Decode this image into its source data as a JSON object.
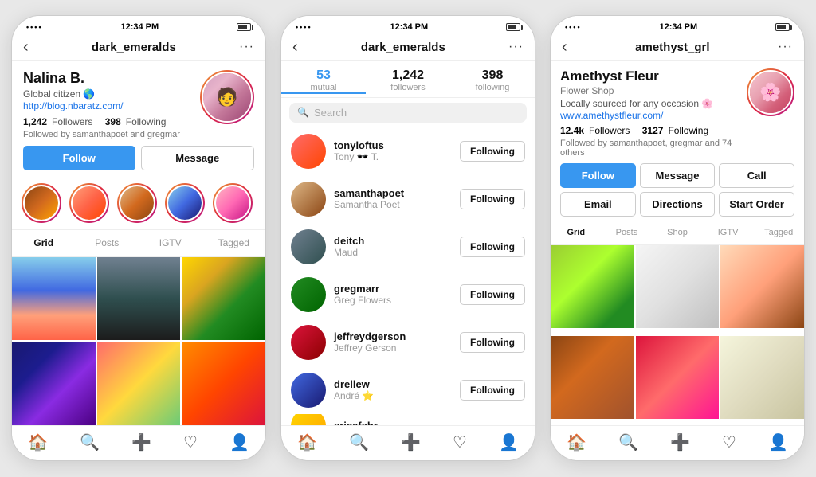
{
  "phones": [
    {
      "id": "phone1",
      "status_bar": {
        "time": "12:34 PM",
        "dots": "••••"
      },
      "nav": {
        "title": "dark_emeralds",
        "back": "‹",
        "menu": "···"
      },
      "profile": {
        "name": "Nalina B.",
        "bio": "Global citizen 🌎",
        "link": "http://blog.nbaratz.com/",
        "followers_count": "1,242",
        "following_count": "398",
        "followers_label": "Followers",
        "following_label": "Following",
        "followed_by": "Followed by samanthapoet and gregmar",
        "btn_follow": "Follow",
        "btn_message": "Message"
      },
      "tabs": [
        {
          "label": "Grid",
          "active": true
        },
        {
          "label": "Posts"
        },
        {
          "label": "IGTV"
        },
        {
          "label": "Tagged"
        }
      ],
      "bottom_nav": [
        "🏠",
        "🔍",
        "➕",
        "♡",
        "👤"
      ]
    },
    {
      "id": "phone2",
      "status_bar": {
        "time": "12:34 PM",
        "dots": "••••"
      },
      "nav": {
        "title": "dark_emeralds",
        "back": "‹",
        "menu": "···"
      },
      "mutual_stats": [
        {
          "num": "53",
          "label": "mutual",
          "active": true
        },
        {
          "num": "1,242",
          "label": "followers"
        },
        {
          "num": "398",
          "label": "following"
        }
      ],
      "search_placeholder": "Search",
      "followers": [
        {
          "username": "tonyloftus",
          "name": "Tony 🕶️ T.",
          "btn": "Following",
          "color": "fa1"
        },
        {
          "username": "samanthapoet",
          "name": "Samantha Poet",
          "btn": "Following",
          "color": "fa2"
        },
        {
          "username": "deitch",
          "name": "Maud",
          "btn": "Following",
          "color": "fa3"
        },
        {
          "username": "gregmarr",
          "name": "Greg Flowers",
          "btn": "Following",
          "color": "fa4"
        },
        {
          "username": "jeffreydgerson",
          "name": "Jeffrey Gerson",
          "btn": "Following",
          "color": "fa5"
        },
        {
          "username": "drellew",
          "name": "André ⭐",
          "btn": "Following",
          "color": "fa6"
        },
        {
          "username": "ericafahr",
          "name": "",
          "btn": "",
          "color": "fa7"
        }
      ],
      "bottom_nav": [
        "🏠",
        "🔍",
        "➕",
        "♡",
        "👤"
      ]
    },
    {
      "id": "phone3",
      "status_bar": {
        "time": "12:34 PM",
        "dots": "••••"
      },
      "nav": {
        "title": "amethyst_grl",
        "back": "‹",
        "menu": "···"
      },
      "profile": {
        "name": "Amethyst Fleur",
        "category": "Flower Shop",
        "bio": "Locally sourced for any occasion 🌸",
        "link": "www.amethystfleur.com/",
        "followers_count": "12.4k",
        "following_count": "3127",
        "followers_label": "Followers",
        "following_label": "Following",
        "followed_by": "Followed by samanthapoet, gregmar and 74 others",
        "btn_follow": "Follow",
        "btn_message": "Message",
        "btn_call": "Call",
        "btn_email": "Email",
        "btn_directions": "Directions",
        "btn_start_order": "Start Order"
      },
      "tabs": [
        {
          "label": "Grid",
          "active": true
        },
        {
          "label": "Posts"
        },
        {
          "label": "Shop"
        },
        {
          "label": "IGTV"
        },
        {
          "label": "Tagged"
        }
      ],
      "bottom_nav": [
        "🏠",
        "🔍",
        "➕",
        "♡",
        "👤"
      ]
    }
  ]
}
